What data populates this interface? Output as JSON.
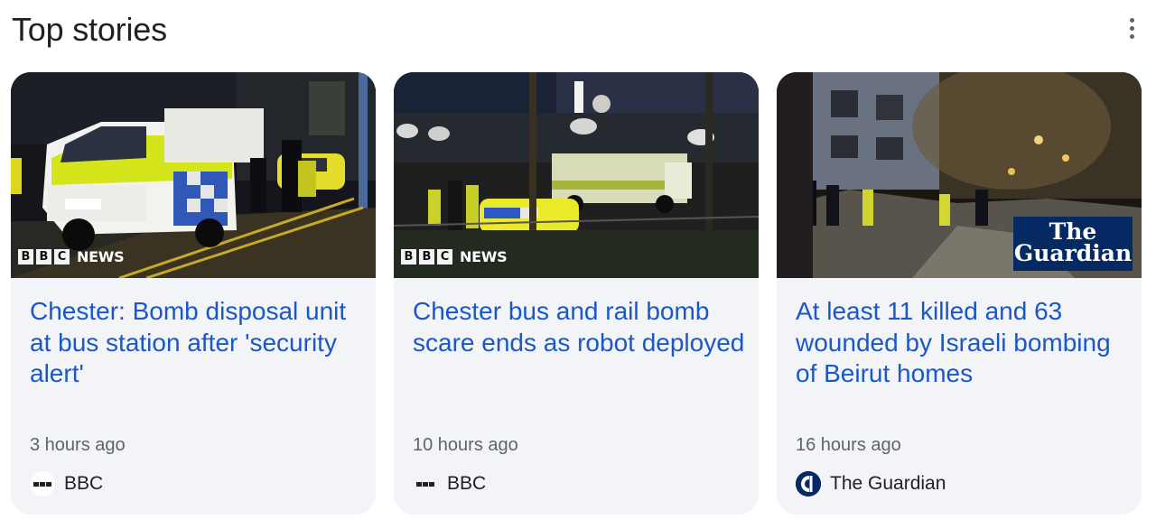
{
  "section": {
    "title": "Top stories",
    "more_icon": "more-vert-icon"
  },
  "cards": [
    {
      "headline": "Chester: Bomb disposal unit at bus station after 'security alert'",
      "time": "3 hours ago",
      "source": "BBC",
      "source_icon": "bbc-logo-icon",
      "image_badge": {
        "blocks": [
          "B",
          "B",
          "C"
        ],
        "word": "NEWS"
      }
    },
    {
      "headline": "Chester bus and rail bomb scare ends as robot deployed",
      "time": "10 hours ago",
      "source": "BBC",
      "source_icon": "bbc-logo-icon",
      "image_badge": {
        "blocks": [
          "B",
          "B",
          "C"
        ],
        "word": "NEWS"
      }
    },
    {
      "headline": "At least 11 killed and 63 wounded by Israeli bombing of Beirut homes",
      "time": "16 hours ago",
      "source": "The Guardian",
      "source_icon": "guardian-logo-icon",
      "image_badge": {
        "line1": "The",
        "line2": "Guardian"
      }
    }
  ],
  "colors": {
    "headline": "#1a57c9",
    "card_bg": "#f3f4f7",
    "guardian_navy": "#052962"
  }
}
